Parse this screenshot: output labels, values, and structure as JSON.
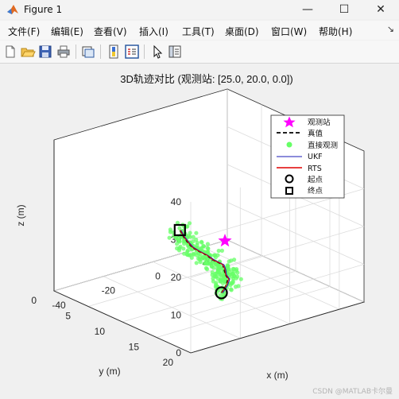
{
  "window": {
    "title": "Figure 1",
    "minimize": "—",
    "maximize": "☐",
    "close": "✕"
  },
  "menu": {
    "items": [
      "文件(F)",
      "编辑(E)",
      "查看(V)",
      "插入(I)",
      "工具(T)",
      "桌面(D)",
      "窗口(W)",
      "帮助(H)"
    ],
    "pin": "↘"
  },
  "toolbar": {
    "icons": [
      "new-figure-icon",
      "open-file-icon",
      "save-icon",
      "print-icon",
      "link-plot-icon",
      "insert-colorbar-icon",
      "insert-legend-icon",
      "edit-plot-pointer-icon",
      "property-inspector-icon"
    ]
  },
  "figure": {
    "title": "3D轨迹对比 (观测站: [25.0, 20.0, 0.0])",
    "xlabel": "x (m)",
    "ylabel": "y (m)",
    "zlabel": "z (m)",
    "xticks": [
      "-40",
      "-20",
      "0",
      "20"
    ],
    "yticks": [
      "0",
      "5",
      "10",
      "15",
      "20"
    ],
    "zticks": [
      "0",
      "10",
      "20",
      "30",
      "40"
    ],
    "legend": [
      "观测站",
      "真值",
      "直接观测",
      "UKF",
      "RTS",
      "起点",
      "终点"
    ],
    "colors": {
      "station": "#ff00ff",
      "truth": "#000000",
      "observation": "#66ff66",
      "ukf": "#1a1ab4",
      "rts": "#e00000"
    }
  },
  "chart_data": {
    "type": "scatter",
    "title": "3D轨迹对比 (观测站: [25.0, 20.0, 0.0])",
    "xlabel": "x (m)",
    "ylabel": "y (m)",
    "zlabel": "z (m)",
    "xlim": [
      -40,
      30
    ],
    "ylim": [
      0,
      20
    ],
    "zlim": [
      0,
      40
    ],
    "grid": true,
    "legend_position": "top-right",
    "station": [
      25.0,
      20.0,
      0.0
    ],
    "trajectory_z": [
      0,
      2.5,
      5,
      7.5,
      10,
      12.5,
      15,
      17.5,
      20,
      22.5,
      25,
      27.5,
      30
    ],
    "series": [
      {
        "name": "真值",
        "kind": "line",
        "x": [
          0.0,
          0.3,
          -1.0,
          -4.5,
          -7.0,
          -10.0,
          -15.0,
          -19.0,
          -24.0,
          -28.5,
          -32.0,
          -35.0,
          -37.5
        ],
        "y": [
          10.0,
          10.6,
          11.3,
          12.2,
          12.9,
          13.8,
          14.2,
          14.6,
          15.4,
          16.0,
          16.6,
          17.1,
          17.5
        ]
      },
      {
        "name": "UKF",
        "kind": "line",
        "x": [
          0.3,
          0.6,
          -0.8,
          -4.3,
          -6.8,
          -9.7,
          -14.6,
          -18.8,
          -23.7,
          -28.2,
          -31.8,
          -34.8,
          -37.3
        ],
        "y": [
          10.1,
          10.7,
          11.5,
          12.3,
          13.1,
          13.9,
          14.3,
          14.8,
          15.5,
          16.1,
          16.8,
          17.2,
          17.6
        ]
      },
      {
        "name": "RTS",
        "kind": "line",
        "x": [
          0.1,
          0.4,
          -0.9,
          -4.4,
          -6.9,
          -9.9,
          -14.9,
          -18.9,
          -23.9,
          -28.4,
          -31.9,
          -34.9,
          -37.4
        ],
        "y": [
          10.0,
          10.6,
          11.4,
          12.2,
          13.0,
          13.8,
          14.2,
          14.7,
          15.4,
          16.0,
          16.7,
          17.1,
          17.5
        ]
      },
      {
        "name": "直接观测",
        "kind": "scatter",
        "points": "noisy observations scattered around 真值 along the whole trajectory"
      }
    ],
    "markers": [
      {
        "name": "观测站",
        "x": 25.0,
        "y": 20.0,
        "z": 0.0
      },
      {
        "name": "起点",
        "x": 0.0,
        "y": 10.0,
        "z": 0.0
      },
      {
        "name": "终点",
        "x": -37.5,
        "y": 17.5,
        "z": 30.0
      }
    ]
  },
  "footer": {
    "watermark": "CSDN @MATLAB卡尔曼"
  }
}
